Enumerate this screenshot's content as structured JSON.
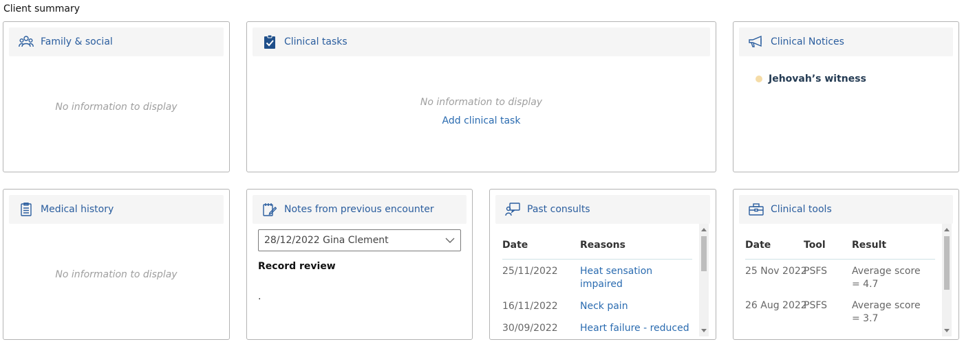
{
  "page": {
    "title": "Client summary"
  },
  "colors": {
    "accent": "#2a5d9e",
    "notice_dot": "#f5dca7"
  },
  "family_social": {
    "title": "Family & social",
    "icon": "people-icon",
    "empty_text": "No information to display"
  },
  "clinical_tasks": {
    "title": "Clinical tasks",
    "icon": "clipboard-check-icon",
    "empty_text": "No information to display",
    "add_link": "Add clinical task"
  },
  "clinical_notices": {
    "title": "Clinical Notices",
    "icon": "megaphone-icon",
    "items": [
      {
        "label": "Jehovah’s witness"
      }
    ]
  },
  "medical_history": {
    "title": "Medical history",
    "icon": "document-list-icon",
    "empty_text": "No information to display"
  },
  "notes_previous": {
    "title": "Notes from previous encounter",
    "icon": "notepad-pen-icon",
    "selected_encounter": "28/12/2022 Gina Clement",
    "record_title": "Record review",
    "record_body": "."
  },
  "past_consults": {
    "title": "Past consults",
    "icon": "consult-chat-icon",
    "columns": [
      "Date",
      "Reasons"
    ],
    "rows": [
      {
        "date": "25/11/2022",
        "reason": "Heat sensation impaired"
      },
      {
        "date": "16/11/2022",
        "reason": "Neck pain"
      },
      {
        "date": "30/09/2022",
        "reason": "Heart failure - reduced"
      }
    ]
  },
  "clinical_tools": {
    "title": "Clinical tools",
    "icon": "toolbox-icon",
    "columns": [
      "Date",
      "Tool",
      "Result"
    ],
    "rows": [
      {
        "date": "25 Nov 2022",
        "tool": "PSFS",
        "result": "Average score = 4.7"
      },
      {
        "date": "26 Aug 2022",
        "tool": "PSFS",
        "result": "Average score = 3.7"
      }
    ]
  }
}
